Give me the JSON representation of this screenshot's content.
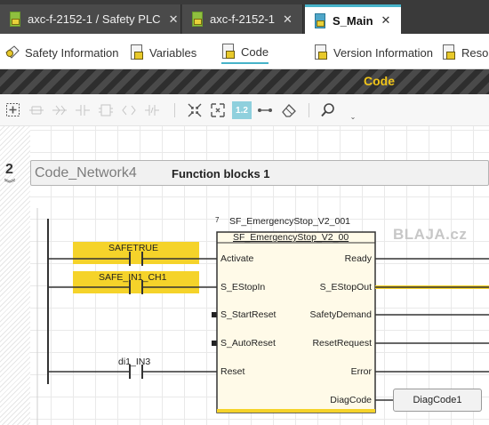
{
  "tabs": [
    {
      "label": "axc-f-2152-1 / Safety PLC",
      "close": "✕"
    },
    {
      "label": "axc-f-2152-1",
      "close": "✕"
    },
    {
      "label": "S_Main",
      "close": "✕"
    }
  ],
  "subtabs": [
    "Safety Information",
    "Variables",
    "Code",
    "Version Information",
    "Reso"
  ],
  "editor_title": "Code",
  "toolbar": {
    "zoom_label": "1.2"
  },
  "network": {
    "number": "2",
    "name": "Code_Network4",
    "comment": "Function blocks 1",
    "block": {
      "index": "7",
      "instance": "SF_EmergencyStop_V2_001",
      "type": "SF_EmergencyStop_V2_00",
      "inputs": [
        "Activate",
        "S_EStopIn",
        "S_StartReset",
        "S_AutoReset",
        "Reset"
      ],
      "outputs": [
        "Ready",
        "S_EStopOut",
        "SafetyDemand",
        "ResetRequest",
        "Error",
        "DiagCode"
      ]
    },
    "contacts": [
      "SAFETRUE",
      "SAFE_IN1_CH1",
      "di1_IN3"
    ],
    "diag_variable": "DiagCode1"
  },
  "watermark": "BLAJA.cz",
  "colors": {
    "accent": "#47b3c9",
    "safety_yellow": "#f5d32a",
    "strip_yellow": "#f0c419"
  }
}
